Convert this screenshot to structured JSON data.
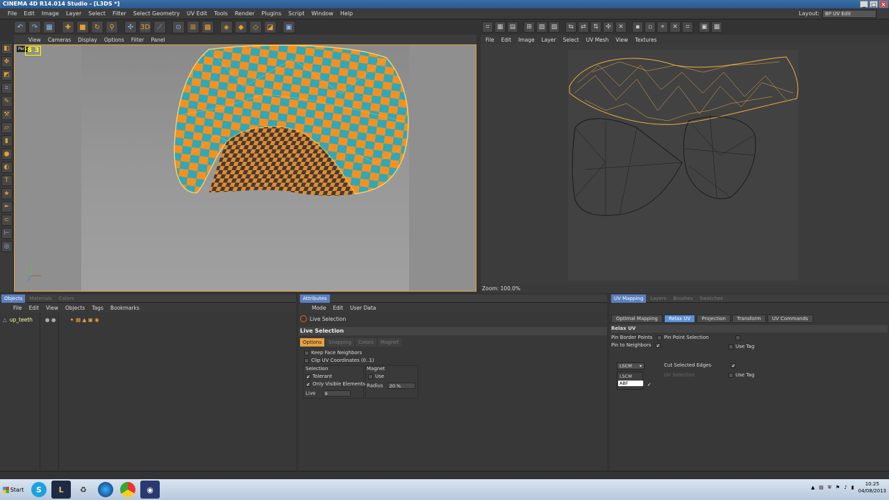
{
  "window": {
    "title": "CINEMA 4D R14.014 Studio - [L3DS *]"
  },
  "menu": [
    "File",
    "Edit",
    "Image",
    "Layer",
    "Select",
    "Filter",
    "Select Geometry",
    "UV Edit",
    "Tools",
    "Render",
    "Plugins",
    "Script",
    "Window",
    "Help"
  ],
  "layout": {
    "label": "Layout:",
    "value": "BP UV Edit"
  },
  "viewport": {
    "menu": [
      "View",
      "Cameras",
      "Display",
      "Options",
      "Filter",
      "Panel"
    ],
    "camera_label": "Pers",
    "fps": "8 3"
  },
  "uv_editor": {
    "menu": [
      "File",
      "Edit",
      "Image",
      "Layer",
      "Select",
      "UV Mesh",
      "View",
      "Textures"
    ],
    "zoom": "Zoom: 100.0%"
  },
  "objects_panel": {
    "tabs": [
      "Objects",
      "Materials",
      "Colors"
    ],
    "menu": [
      "File",
      "Edit",
      "View",
      "Objects",
      "Tags",
      "Bookmarks"
    ],
    "object_name": "up_teeth"
  },
  "attributes_panel": {
    "tabs": [
      "Attributes"
    ],
    "menu": [
      "Mode",
      "Edit",
      "User Data"
    ],
    "tool_name": "Live Selection",
    "section": "Live Selection",
    "subtabs": [
      "Options",
      "Snapping",
      "Colors",
      "Magnet"
    ],
    "keep_face_neighbors": "Keep Face Neighbors",
    "clip_uv": "Clip UV Coordinates (0..1)",
    "selection_title": "Selection",
    "tolerant": "Tolerant",
    "only_visible": "Only Visible Elements",
    "live_label": "Live",
    "live_value": "9",
    "magnet_title": "Magnet",
    "use": "Use",
    "radius_label": "Radius",
    "radius_value": "20 %"
  },
  "uv_panel": {
    "tabs": [
      "UV Mapping",
      "Layers",
      "Brushes",
      "Swatches"
    ],
    "buttons": [
      "Optimal Mapping",
      "Relax UV",
      "Projection",
      "Transform",
      "UV Commands"
    ],
    "section": "Relax UV",
    "pin_border": "Pin Border Points",
    "pin_neighbors": "Pin to Neighbors",
    "pin_point": "Pin Point Selection",
    "use_tag_1": "Use Tag",
    "method_value": "LSCM",
    "method_options": [
      "LSCM",
      "ABF"
    ],
    "cut_edges": "Cut Selected Edges",
    "uv_selection": "UV Selection",
    "use_tag_2": "Use Tag"
  },
  "taskbar": {
    "start": "Start",
    "time": "10:25",
    "date": "04/08/2013"
  }
}
